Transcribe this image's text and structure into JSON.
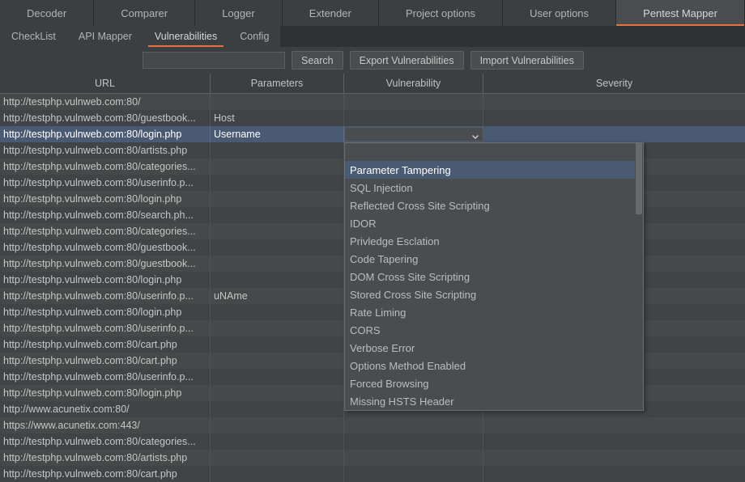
{
  "top_tabs": [
    {
      "label": "Decoder",
      "active": false
    },
    {
      "label": "Comparer",
      "active": false
    },
    {
      "label": "Logger",
      "active": false
    },
    {
      "label": "Extender",
      "active": false
    },
    {
      "label": "Project options",
      "active": false
    },
    {
      "label": "User options",
      "active": false
    },
    {
      "label": "Pentest Mapper",
      "active": true
    }
  ],
  "sub_tabs": [
    {
      "label": "CheckList",
      "active": false
    },
    {
      "label": "API Mapper",
      "active": false
    },
    {
      "label": "Vulnerabilities",
      "active": true
    },
    {
      "label": "Config",
      "active": false
    }
  ],
  "toolbar": {
    "search_value": "",
    "search_placeholder": "",
    "search_label": "Search",
    "export_label": "Export Vulnerabilities",
    "import_label": "Import Vulnerabilities"
  },
  "table": {
    "columns": [
      "URL",
      "Parameters",
      "Vulnerability",
      "Severity"
    ],
    "rows": [
      {
        "url": "http://testphp.vulnweb.com:80/",
        "parameters": "",
        "vulnerability": "",
        "severity": "",
        "selected": false
      },
      {
        "url": "http://testphp.vulnweb.com:80/guestbook...",
        "parameters": "Host",
        "vulnerability": "",
        "severity": "",
        "selected": false
      },
      {
        "url": "http://testphp.vulnweb.com:80/login.php",
        "parameters": "Username",
        "vulnerability": "",
        "severity": "",
        "selected": true
      },
      {
        "url": "http://testphp.vulnweb.com:80/artists.php",
        "parameters": "",
        "vulnerability": "",
        "severity": "",
        "selected": false
      },
      {
        "url": "http://testphp.vulnweb.com:80/categories...",
        "parameters": "",
        "vulnerability": "",
        "severity": "",
        "selected": false
      },
      {
        "url": "http://testphp.vulnweb.com:80/userinfo.p...",
        "parameters": "",
        "vulnerability": "",
        "severity": "",
        "selected": false
      },
      {
        "url": "http://testphp.vulnweb.com:80/login.php",
        "parameters": "",
        "vulnerability": "",
        "severity": "",
        "selected": false
      },
      {
        "url": "http://testphp.vulnweb.com:80/search.ph...",
        "parameters": "",
        "vulnerability": "",
        "severity": "",
        "selected": false
      },
      {
        "url": "http://testphp.vulnweb.com:80/categories...",
        "parameters": "",
        "vulnerability": "",
        "severity": "",
        "selected": false
      },
      {
        "url": "http://testphp.vulnweb.com:80/guestbook...",
        "parameters": "",
        "vulnerability": "",
        "severity": "",
        "selected": false
      },
      {
        "url": "http://testphp.vulnweb.com:80/guestbook...",
        "parameters": "",
        "vulnerability": "",
        "severity": "",
        "selected": false
      },
      {
        "url": "http://testphp.vulnweb.com:80/login.php",
        "parameters": "",
        "vulnerability": "",
        "severity": "",
        "selected": false
      },
      {
        "url": "http://testphp.vulnweb.com:80/userinfo.p...",
        "parameters": "uNAme",
        "vulnerability": "",
        "severity": "",
        "selected": false
      },
      {
        "url": "http://testphp.vulnweb.com:80/login.php",
        "parameters": "",
        "vulnerability": "",
        "severity": "",
        "selected": false
      },
      {
        "url": "http://testphp.vulnweb.com:80/userinfo.p...",
        "parameters": "",
        "vulnerability": "",
        "severity": "",
        "selected": false
      },
      {
        "url": "http://testphp.vulnweb.com:80/cart.php",
        "parameters": "",
        "vulnerability": "",
        "severity": "",
        "selected": false
      },
      {
        "url": "http://testphp.vulnweb.com:80/cart.php",
        "parameters": "",
        "vulnerability": "",
        "severity": "",
        "selected": false
      },
      {
        "url": "http://testphp.vulnweb.com:80/userinfo.p...",
        "parameters": "",
        "vulnerability": "",
        "severity": "",
        "selected": false
      },
      {
        "url": "http://testphp.vulnweb.com:80/login.php",
        "parameters": "",
        "vulnerability": "",
        "severity": "",
        "selected": false
      },
      {
        "url": "http://www.acunetix.com:80/",
        "parameters": "",
        "vulnerability": "",
        "severity": "",
        "selected": false
      },
      {
        "url": "https://www.acunetix.com:443/",
        "parameters": "",
        "vulnerability": "",
        "severity": "",
        "selected": false
      },
      {
        "url": "http://testphp.vulnweb.com:80/categories...",
        "parameters": "",
        "vulnerability": "",
        "severity": "",
        "selected": false
      },
      {
        "url": "http://testphp.vulnweb.com:80/artists.php",
        "parameters": "",
        "vulnerability": "",
        "severity": "",
        "selected": false
      },
      {
        "url": "http://testphp.vulnweb.com:80/cart.php",
        "parameters": "",
        "vulnerability": "",
        "severity": "",
        "selected": false
      }
    ]
  },
  "vulnerability_editor": {
    "selected_value": "",
    "dropdown_open": true,
    "icon": "chevron-down-icon",
    "options": [
      {
        "label": "",
        "selected": false
      },
      {
        "label": "Parameter Tampering",
        "selected": true
      },
      {
        "label": "SQL Injection",
        "selected": false
      },
      {
        "label": "Reflected Cross Site Scripting",
        "selected": false
      },
      {
        "label": "IDOR",
        "selected": false
      },
      {
        "label": "Privledge Esclation",
        "selected": false
      },
      {
        "label": "Code Tapering",
        "selected": false
      },
      {
        "label": "DOM Cross Site Scripting",
        "selected": false
      },
      {
        "label": "Stored Cross Site Scripting",
        "selected": false
      },
      {
        "label": "Rate Liming",
        "selected": false
      },
      {
        "label": "CORS",
        "selected": false
      },
      {
        "label": "Verbose Error",
        "selected": false
      },
      {
        "label": "Options Method Enabled",
        "selected": false
      },
      {
        "label": "Forced Browsing",
        "selected": false
      },
      {
        "label": "Missing HSTS Header",
        "selected": false
      }
    ]
  },
  "colors": {
    "accent": "#e8703a",
    "selection": "#4b5a73",
    "background": "#3c3f41",
    "tabbar": "#2b2b2b",
    "row_odd": "#45494a",
    "row_even": "#414446"
  }
}
